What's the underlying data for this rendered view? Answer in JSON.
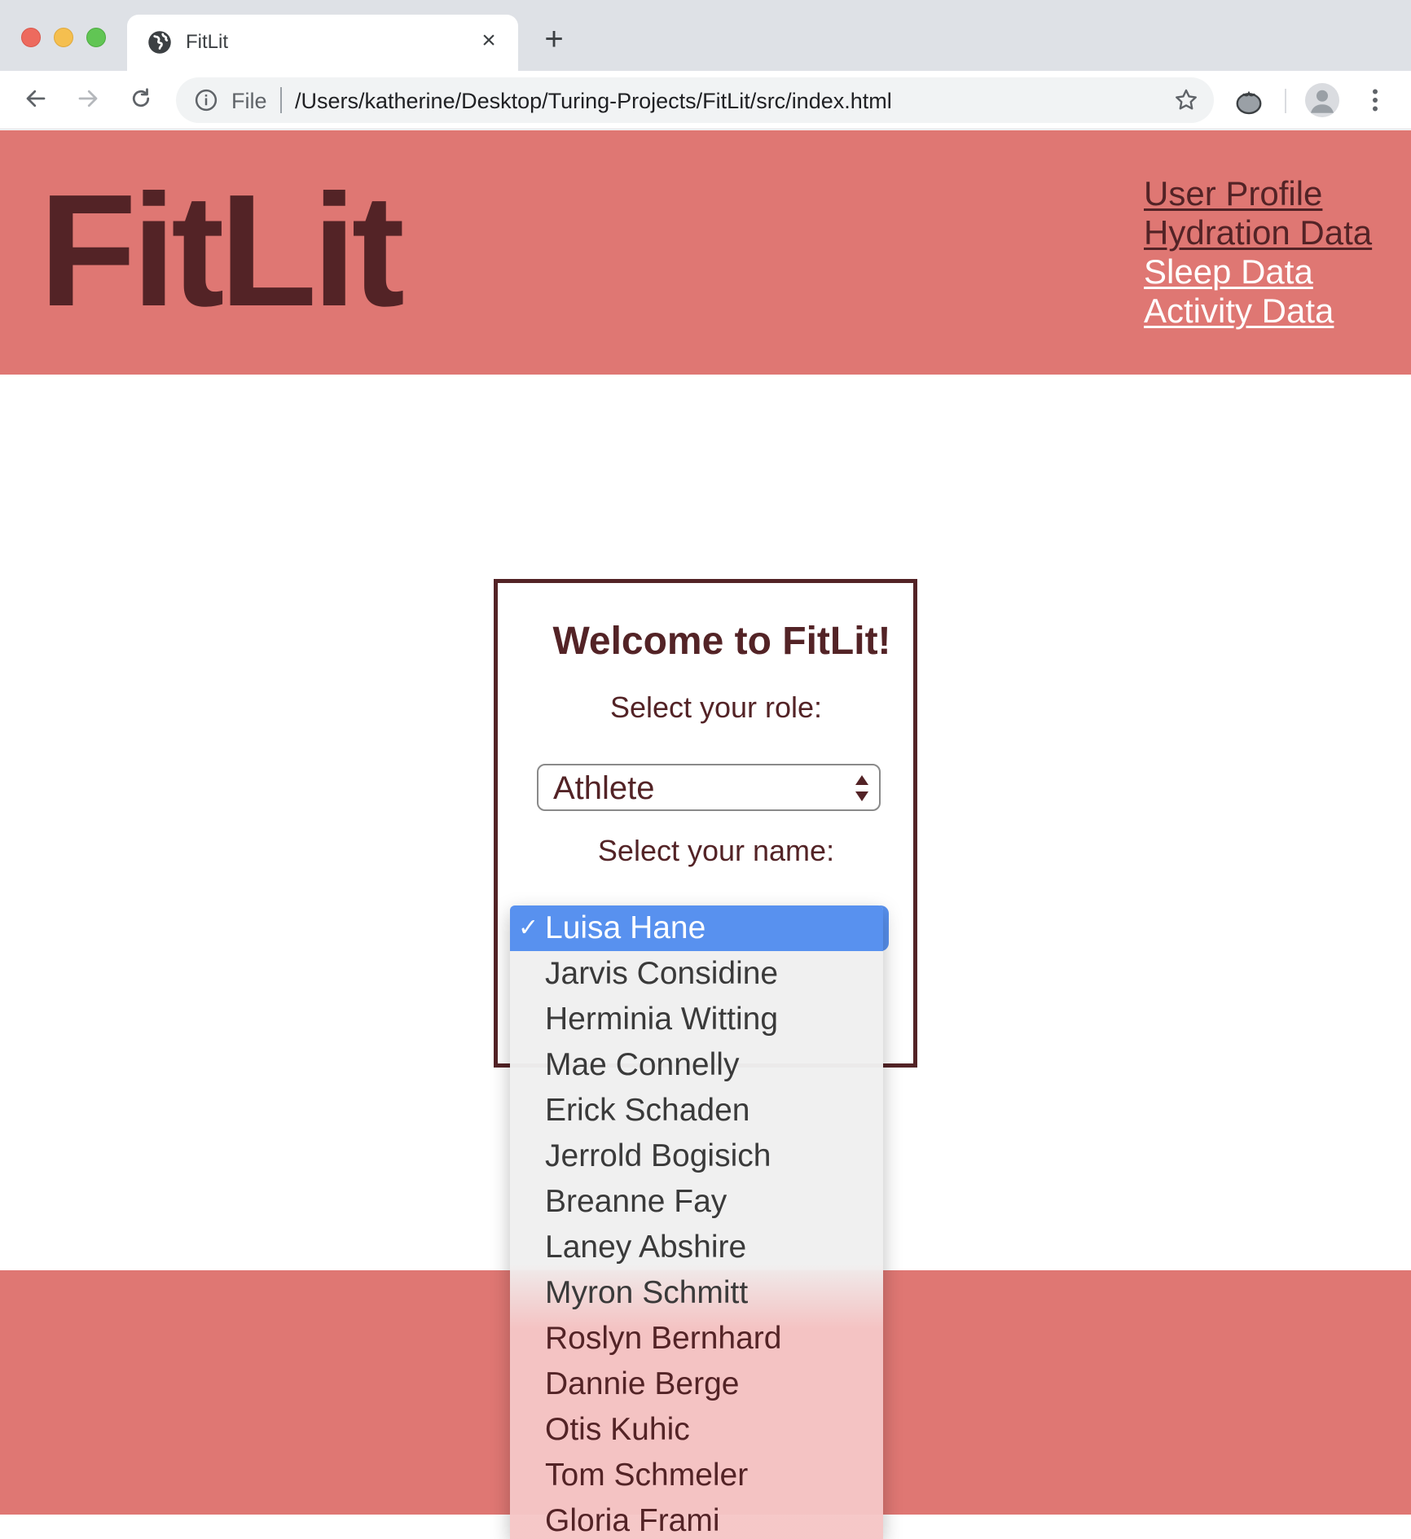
{
  "browser": {
    "tab_title": "FitLit",
    "tab_close": "×",
    "new_tab": "+",
    "url_scheme": "File",
    "url": "/Users/katherine/Desktop/Turing-Projects/FitLit/src/index.html"
  },
  "header": {
    "logo": "FitLit",
    "nav": [
      {
        "label": "User Profile",
        "style": "dark"
      },
      {
        "label": "Hydration Data",
        "style": "dark"
      },
      {
        "label": "Sleep Data",
        "style": "light"
      },
      {
        "label": "Activity Data",
        "style": "light"
      }
    ]
  },
  "welcome": {
    "title": "Welcome to FitLit!",
    "role_label": "Select your role:",
    "role_value": "Athlete",
    "name_label": "Select your name:"
  },
  "name_dropdown": {
    "check": "✓",
    "options": [
      "Luisa Hane",
      "Jarvis Considine",
      "Herminia Witting",
      "Mae Connelly",
      "Erick Schaden",
      "Jerrold Bogisich",
      "Breanne Fay",
      "Laney Abshire",
      "Myron Schmitt",
      "Roslyn Bernhard",
      "Dannie Berge",
      "Otis Kuhic",
      "Tom Schmeler",
      "Gloria Frami"
    ],
    "selected_index": 0
  },
  "colors": {
    "brand_bg": "#df7773",
    "brand_dark": "#532326",
    "selection_blue": "#5891ef"
  }
}
